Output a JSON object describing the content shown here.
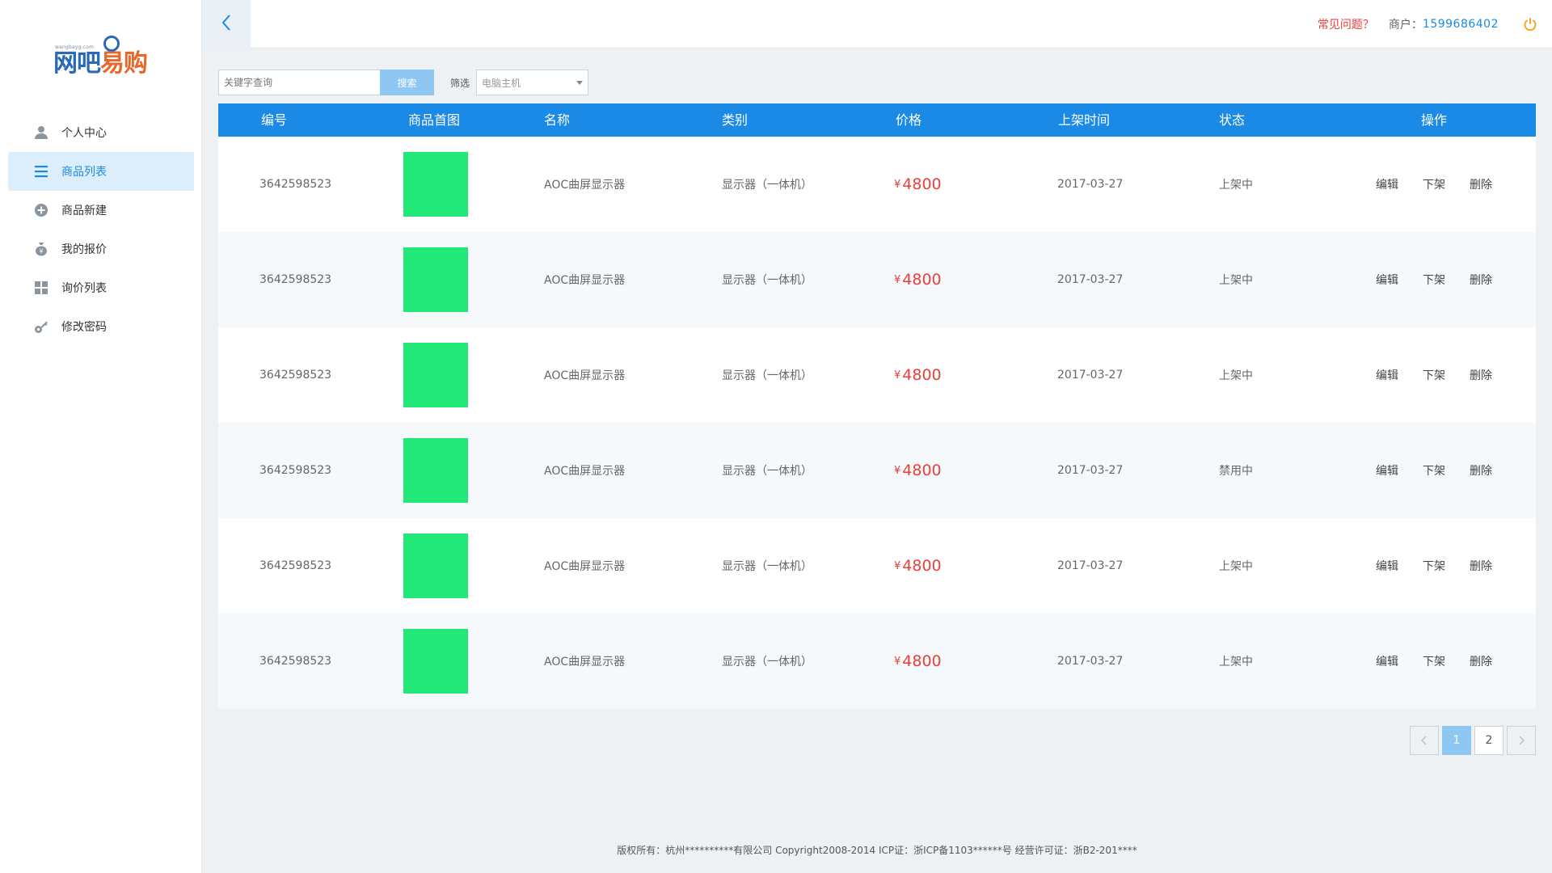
{
  "brand": {
    "site": "wangbayg.com",
    "name_part1": "网吧",
    "name_part2": "易购"
  },
  "sidebar": {
    "items": [
      {
        "label": "个人中心",
        "icon": "user-icon"
      },
      {
        "label": "商品列表",
        "icon": "list-icon",
        "active": true
      },
      {
        "label": "商品新建",
        "icon": "add-circle-icon"
      },
      {
        "label": "我的报价",
        "icon": "money-bag-icon"
      },
      {
        "label": "询价列表",
        "icon": "grid-icon"
      },
      {
        "label": "修改密码",
        "icon": "key-icon"
      }
    ]
  },
  "topbar": {
    "faq": "常见问题？",
    "merchant_label": "商户：",
    "merchant_id": "1599686402"
  },
  "toolbar": {
    "search_placeholder": "关键字查询",
    "search_button": "搜索",
    "filter_label": "筛选",
    "filter_value": "电脑主机"
  },
  "table": {
    "headers": [
      "编号",
      "商品首图",
      "名称",
      "类别",
      "价格",
      "上架时间",
      "状态",
      "操作"
    ],
    "rows": [
      {
        "id": "3642598523",
        "name": "AOC曲屏显示器",
        "category": "显示器（一体机）",
        "currency": "¥",
        "price": "4800",
        "date": "2017-03-27",
        "status": "上架中",
        "ops": [
          "编辑",
          "下架",
          "删除"
        ]
      },
      {
        "id": "3642598523",
        "name": "AOC曲屏显示器",
        "category": "显示器（一体机）",
        "currency": "¥",
        "price": "4800",
        "date": "2017-03-27",
        "status": "上架中",
        "ops": [
          "编辑",
          "下架",
          "删除"
        ]
      },
      {
        "id": "3642598523",
        "name": "AOC曲屏显示器",
        "category": "显示器（一体机）",
        "currency": "¥",
        "price": "4800",
        "date": "2017-03-27",
        "status": "上架中",
        "ops": [
          "编辑",
          "下架",
          "删除"
        ]
      },
      {
        "id": "3642598523",
        "name": "AOC曲屏显示器",
        "category": "显示器（一体机）",
        "currency": "¥",
        "price": "4800",
        "date": "2017-03-27",
        "status": "禁用中",
        "ops": [
          "编辑",
          "下架",
          "删除"
        ]
      },
      {
        "id": "3642598523",
        "name": "AOC曲屏显示器",
        "category": "显示器（一体机）",
        "currency": "¥",
        "price": "4800",
        "date": "2017-03-27",
        "status": "上架中",
        "ops": [
          "编辑",
          "下架",
          "删除"
        ]
      },
      {
        "id": "3642598523",
        "name": "AOC曲屏显示器",
        "category": "显示器（一体机）",
        "currency": "¥",
        "price": "4800",
        "date": "2017-03-27",
        "status": "上架中",
        "ops": [
          "编辑",
          "下架",
          "删除"
        ]
      }
    ]
  },
  "pagination": {
    "pages": [
      "1",
      "2"
    ],
    "current": "1"
  },
  "footer": {
    "text": "版权所有：杭州**********有限公司 Copyright2008-2014 ICP证：浙ICP备1103******号 经营许可证：浙B2-201****"
  },
  "colors": {
    "primary": "#1a8ae6",
    "price": "#e8403b",
    "thumb": "#22e87a",
    "faq": "#e8403b",
    "power": "#f5a623"
  }
}
